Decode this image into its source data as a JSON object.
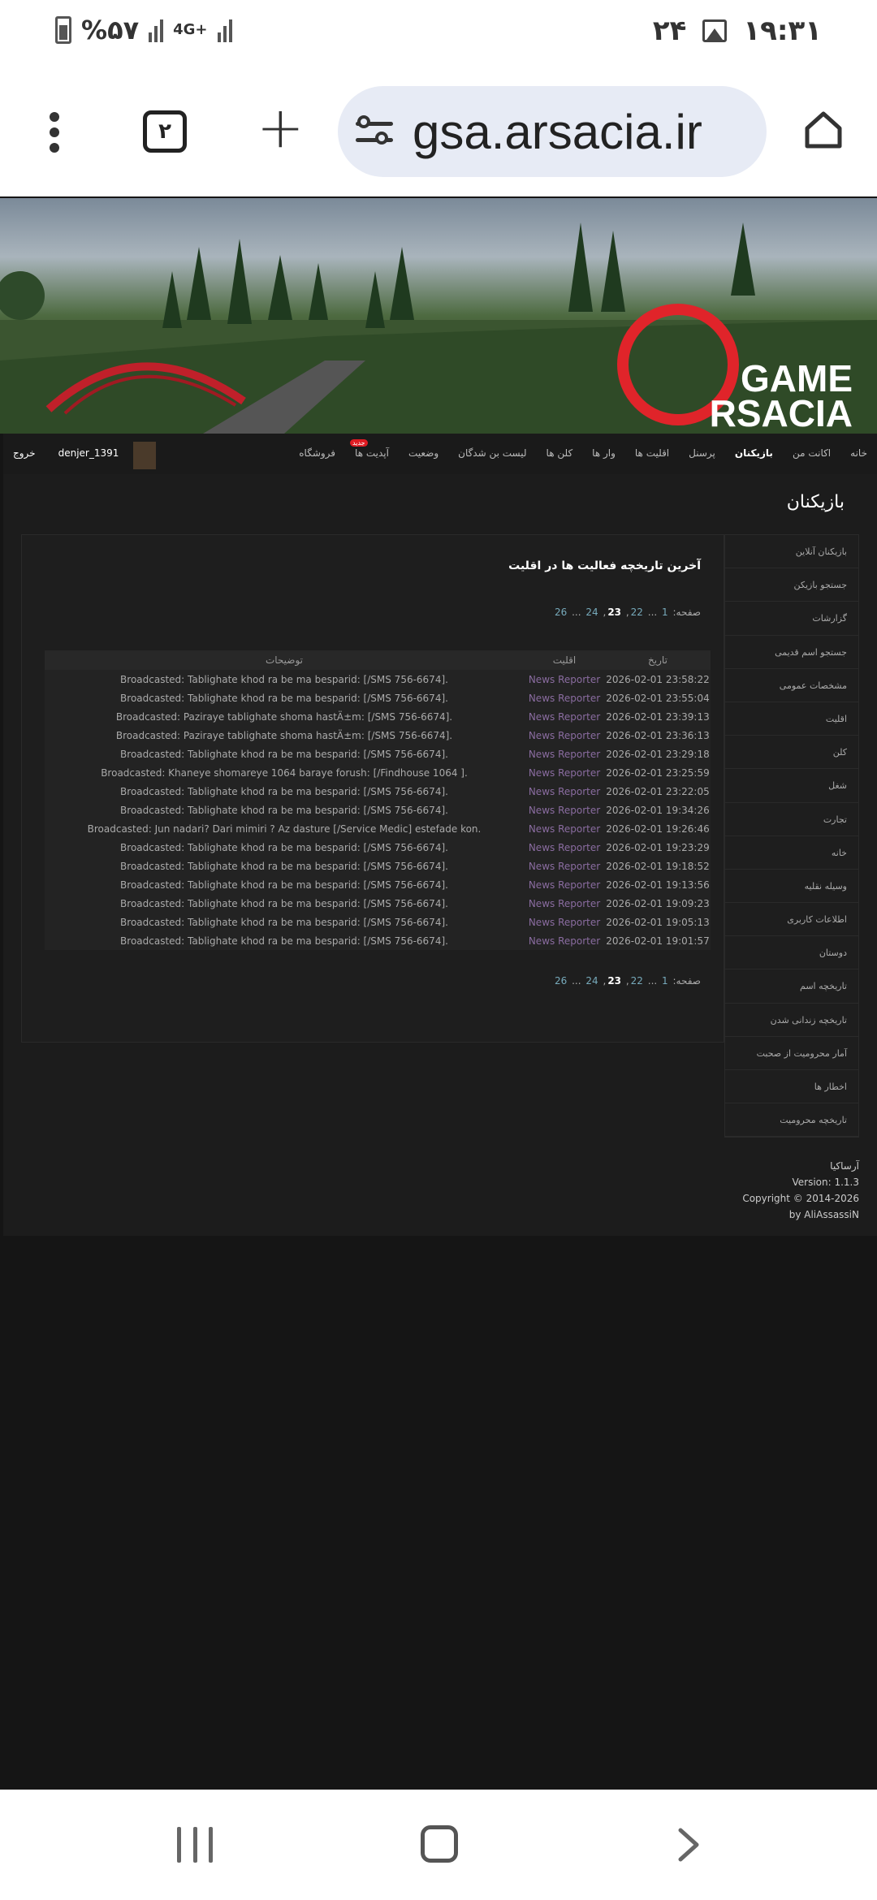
{
  "status": {
    "battery": "%۵۷",
    "network": "4G+",
    "date": "۲۴",
    "time": "۱۹:۳۱"
  },
  "browser": {
    "tab_count": "۲",
    "url": "gsa.arsacia.ir"
  },
  "banner": {
    "logo_line1": "GAME",
    "logo_line2": "RSACIA"
  },
  "nav": {
    "items": [
      "خانه",
      "اکانت من",
      "بازیکنان",
      "پرسنل",
      "اقلیت ها",
      "وار ها",
      "کلن ها",
      "لیست بن شدگان",
      "وضعیت",
      "آپدیت ها",
      "فروشگاه"
    ],
    "badge": "جدید",
    "username": "denjer_1391",
    "logout": "خروج"
  },
  "page": {
    "section_title": "بازیکنان",
    "panel_title": "آخرین تاریخچه فعالیت ها در اقلیت",
    "pager_label": "صفحه:",
    "pager": [
      "1",
      "...",
      "22",
      "23",
      "24",
      "...",
      "26"
    ]
  },
  "sidebar": {
    "items": [
      "بازیکنان آنلاین",
      "جستجو بازیکن",
      "گزارشات",
      "جستجو اسم قدیمی",
      "مشخصات عمومی",
      "اقلیت",
      "کلن",
      "شغل",
      "تجارت",
      "خانه",
      "وسیله نقلیه",
      "اطلاعات کاربری",
      "دوستان",
      "تاریخچه اسم",
      "تاریخچه زندانی شدن",
      "آمار محرومیت از صحبت",
      "اخطار ها",
      "تاریخچه محرومیت"
    ]
  },
  "table": {
    "headers": {
      "date": "تاریخ",
      "faction": "اقلیت",
      "desc": "توضیحات"
    },
    "rows": [
      [
        "2026-02-01 23:58:22",
        "News Reporter",
        "Broadcasted: Tablighate khod ra be ma besparid: [/SMS 756-6674]."
      ],
      [
        "2026-02-01 23:55:04",
        "News Reporter",
        "Broadcasted: Tablighate khod ra be ma besparid: [/SMS 756-6674]."
      ],
      [
        "2026-02-01 23:39:13",
        "News Reporter",
        "Broadcasted: Paziraye tablighate shoma hastÄ±m: [/SMS 756-6674]."
      ],
      [
        "2026-02-01 23:36:13",
        "News Reporter",
        "Broadcasted: Paziraye tablighate shoma hastÄ±m: [/SMS 756-6674]."
      ],
      [
        "2026-02-01 23:29:18",
        "News Reporter",
        "Broadcasted: Tablighate khod ra be ma besparid: [/SMS 756-6674]."
      ],
      [
        "2026-02-01 23:25:59",
        "News Reporter",
        "Broadcasted: Khaneye shomareye 1064 baraye forush: [/Findhouse 1064 ]."
      ],
      [
        "2026-02-01 23:22:05",
        "News Reporter",
        "Broadcasted: Tablighate khod ra be ma besparid: [/SMS 756-6674]."
      ],
      [
        "2026-02-01 19:34:26",
        "News Reporter",
        "Broadcasted: Tablighate khod ra be ma besparid: [/SMS 756-6674]."
      ],
      [
        "2026-02-01 19:26:46",
        "News Reporter",
        "Broadcasted: Jun nadari? Dari mimiri ? Az dasture [/Service Medic] estefade kon."
      ],
      [
        "2026-02-01 19:23:29",
        "News Reporter",
        "Broadcasted: Tablighate khod ra be ma besparid: [/SMS 756-6674]."
      ],
      [
        "2026-02-01 19:18:52",
        "News Reporter",
        "Broadcasted: Tablighate khod ra be ma besparid: [/SMS 756-6674]."
      ],
      [
        "2026-02-01 19:13:56",
        "News Reporter",
        "Broadcasted: Tablighate khod ra be ma besparid: [/SMS 756-6674]."
      ],
      [
        "2026-02-01 19:09:23",
        "News Reporter",
        "Broadcasted: Tablighate khod ra be ma besparid: [/SMS 756-6674]."
      ],
      [
        "2026-02-01 19:05:13",
        "News Reporter",
        "Broadcasted: Tablighate khod ra be ma besparid: [/SMS 756-6674]."
      ],
      [
        "2026-02-01 19:01:57",
        "News Reporter",
        "Broadcasted: Tablighate khod ra be ma besparid: [/SMS 756-6674]."
      ]
    ]
  },
  "footer": {
    "lines": [
      "آرساکیا",
      "Version: 1.1.3",
      "Copyright © 2014-2026",
      "by AliAssassiN"
    ]
  },
  "colors": {
    "background": "#151515",
    "panel": "#1e1e1e",
    "faction_text": "#8a6ca0",
    "link": "#77aabb",
    "badge": "#e01b22",
    "logo_red": "#e0242a"
  }
}
